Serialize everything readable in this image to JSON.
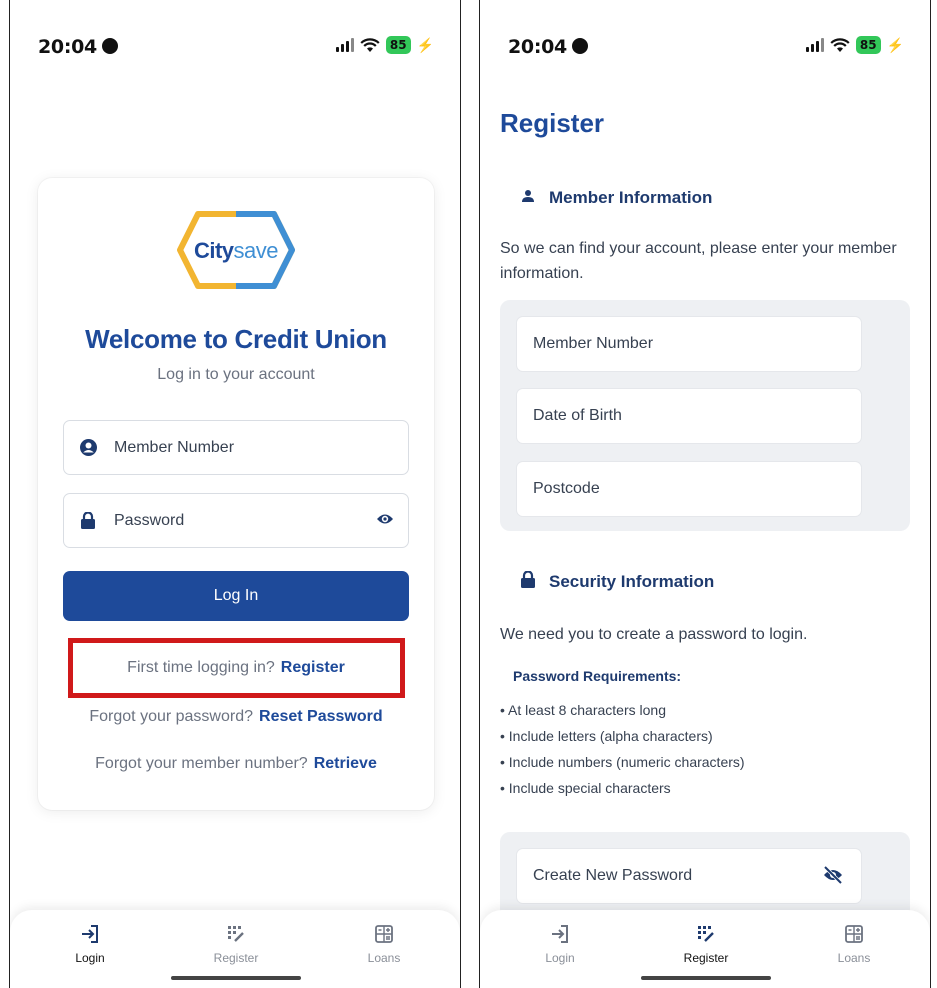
{
  "status": {
    "time": "20:04",
    "battery": "85"
  },
  "login": {
    "logo_bold": "City",
    "logo_light": "save",
    "title": "Welcome to Credit Union",
    "subtitle": "Log in to your account",
    "member_field": {
      "placeholder": "Member Number",
      "icon": "user-circle-icon"
    },
    "password_field": {
      "placeholder": "Password",
      "icon": "lock-icon",
      "toggle_icon": "eye-icon"
    },
    "login_button": "Log In",
    "first_time_text": "First time logging in?",
    "register_link": "Register",
    "forgot_password_text": "Forgot your password?",
    "reset_link": "Reset Password",
    "forgot_member_text": "Forgot your member number?",
    "retrieve_link": "Retrieve",
    "highlight_color": "#d0191a"
  },
  "register": {
    "title": "Register",
    "member_section": {
      "heading": "Member Information",
      "icon": "person-icon",
      "description": "So we can find your account, please enter your member information."
    },
    "member_fields": [
      "Member Number",
      "Date of Birth",
      "Postcode"
    ],
    "security_section": {
      "heading": "Security Information",
      "icon": "lock-icon",
      "description": "We need you to create a password to login."
    },
    "requirements_title": "Password Requirements:",
    "requirements": [
      "• At least 8 characters long",
      "• Include letters (alpha characters)",
      "• Include numbers (numeric characters)",
      "• Include special characters"
    ],
    "new_password_field": {
      "placeholder": "Create New Password",
      "toggle_icon": "eye-slash-icon"
    }
  },
  "tabs": [
    {
      "label": "Login",
      "icon": "login-arrow-icon"
    },
    {
      "label": "Register",
      "icon": "register-grid-icon"
    },
    {
      "label": "Loans",
      "icon": "calculator-icon"
    }
  ],
  "colors": {
    "brand_blue": "#1e4a9a",
    "logo_yellow": "#f2b531",
    "logo_blue": "#3f8fd4"
  }
}
